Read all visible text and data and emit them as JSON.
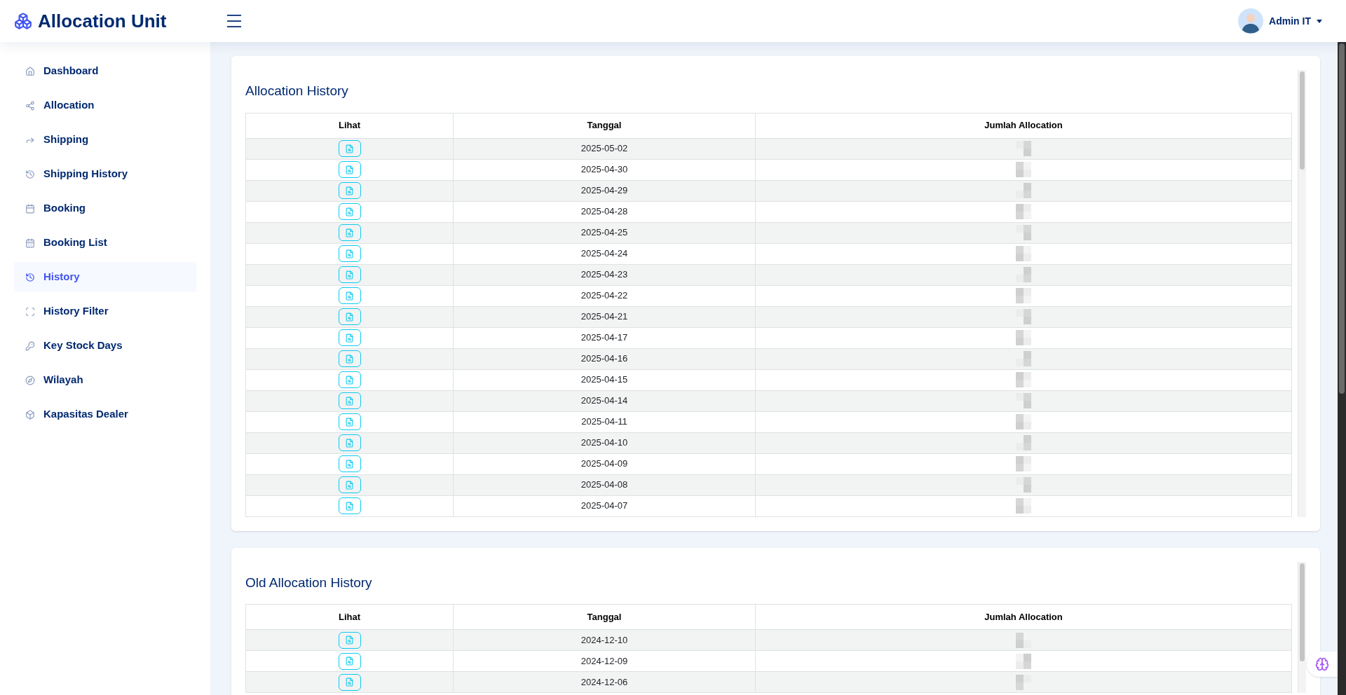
{
  "header": {
    "title": "Allocation Unit",
    "user": "Admin IT"
  },
  "sidebar": {
    "items": [
      {
        "label": "Dashboard",
        "selected": false
      },
      {
        "label": "Allocation",
        "selected": false
      },
      {
        "label": "Shipping",
        "selected": false
      },
      {
        "label": "Shipping History",
        "selected": false
      },
      {
        "label": "Booking",
        "selected": false
      },
      {
        "label": "Booking List",
        "selected": false
      },
      {
        "label": "History",
        "selected": true
      },
      {
        "label": "History Filter",
        "selected": false
      },
      {
        "label": "Key Stock Days",
        "selected": false
      },
      {
        "label": "Wilayah",
        "selected": false
      },
      {
        "label": "Kapasitas Dealer",
        "selected": false
      }
    ]
  },
  "sections": [
    {
      "title": "Allocation History",
      "columns": [
        "Lihat",
        "Tanggal",
        "Jumlah Allocation"
      ],
      "rows": [
        {
          "date": "2025-05-02"
        },
        {
          "date": "2025-04-30"
        },
        {
          "date": "2025-04-29"
        },
        {
          "date": "2025-04-28"
        },
        {
          "date": "2025-04-25"
        },
        {
          "date": "2025-04-24"
        },
        {
          "date": "2025-04-23"
        },
        {
          "date": "2025-04-22"
        },
        {
          "date": "2025-04-21"
        },
        {
          "date": "2025-04-17"
        },
        {
          "date": "2025-04-16"
        },
        {
          "date": "2025-04-15"
        },
        {
          "date": "2025-04-14"
        },
        {
          "date": "2025-04-11"
        },
        {
          "date": "2025-04-10"
        },
        {
          "date": "2025-04-09"
        },
        {
          "date": "2025-04-08"
        },
        {
          "date": "2025-04-07"
        }
      ]
    },
    {
      "title": "Old Allocation History",
      "columns": [
        "Lihat",
        "Tanggal",
        "Jumlah Allocation"
      ],
      "rows": [
        {
          "date": "2024-12-10"
        },
        {
          "date": "2024-12-09"
        },
        {
          "date": "2024-12-06"
        }
      ]
    }
  ]
}
